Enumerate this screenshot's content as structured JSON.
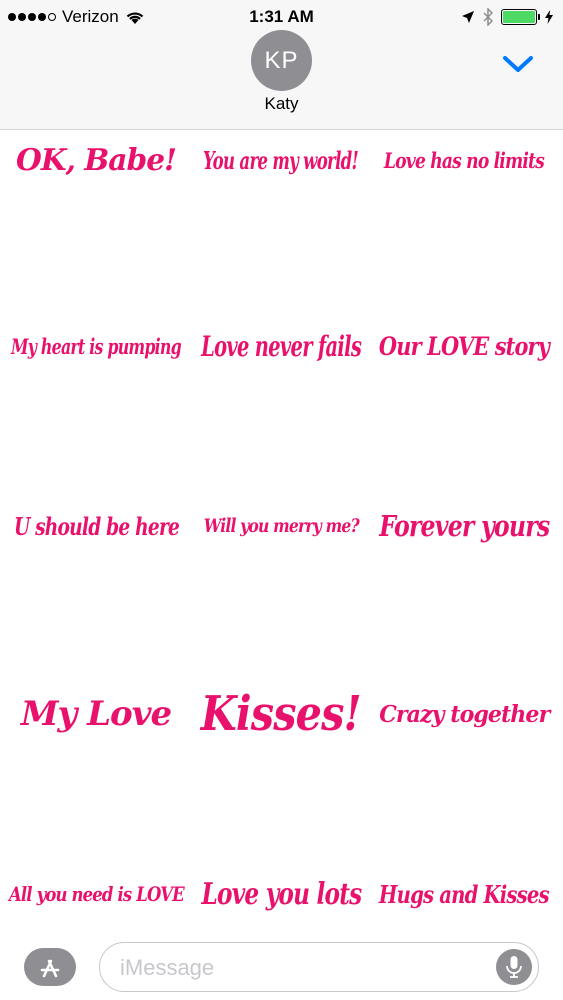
{
  "status_bar": {
    "carrier": "Verizon",
    "time": "1:31 AM",
    "signal_bars_filled": 4,
    "signal_bars_total": 5,
    "battery_level": 1.0,
    "battery_color": "#4cd964"
  },
  "header": {
    "avatar_initials": "KP",
    "contact_name": "Katy",
    "collapse_icon": "chevron-down-icon",
    "accent_color": "#007aff"
  },
  "stickers": [
    "OK, Babe!",
    "You are my world!",
    "Love has no limits",
    "My heart is pumping",
    "Love never fails",
    "Our LOVE story",
    "U should be here",
    "Will you merry me?",
    "Forever yours",
    "My Love",
    "Kisses!",
    "Crazy together",
    "All you need is LOVE",
    "Love you lots",
    "Hugs and Kisses"
  ],
  "sticker_color": "#e8126d",
  "input_bar": {
    "placeholder": "iMessage",
    "apps_icon": "app-store-icon",
    "mic_icon": "microphone-icon"
  }
}
